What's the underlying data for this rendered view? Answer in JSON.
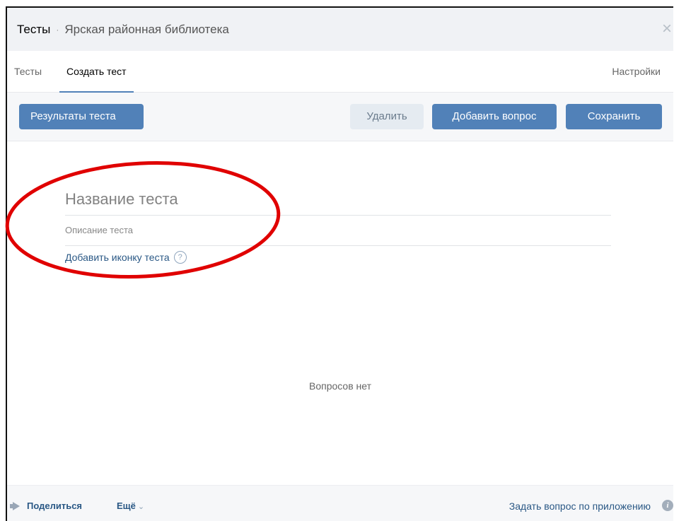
{
  "titlebar": {
    "app_name": "Тесты",
    "separator": "·",
    "group_name": "Ярская районная библиотека",
    "close_glyph": "×"
  },
  "tabs": {
    "tests": "Тесты",
    "create": "Создать тест",
    "settings": "Настройки"
  },
  "toolbar": {
    "results": "Результаты теста",
    "delete": "Удалить",
    "add_question": "Добавить вопрос",
    "save": "Сохранить"
  },
  "form": {
    "title_placeholder": "Название теста",
    "description_placeholder": "Описание теста",
    "add_icon_link": "Добавить иконку теста",
    "help_glyph": "?"
  },
  "empty_state": "Вопросов нет",
  "footer": {
    "share": "Поделиться",
    "more": "Ещё",
    "more_chevron": "⌄",
    "ask": "Задать вопрос по приложению",
    "info_glyph": "i"
  },
  "colors": {
    "accent": "#5181b8",
    "link": "#2a5885",
    "annotation": "#e00000"
  },
  "icons": [
    "close-icon",
    "help-icon",
    "megaphone-icon",
    "chevron-down-icon",
    "info-icon"
  ]
}
